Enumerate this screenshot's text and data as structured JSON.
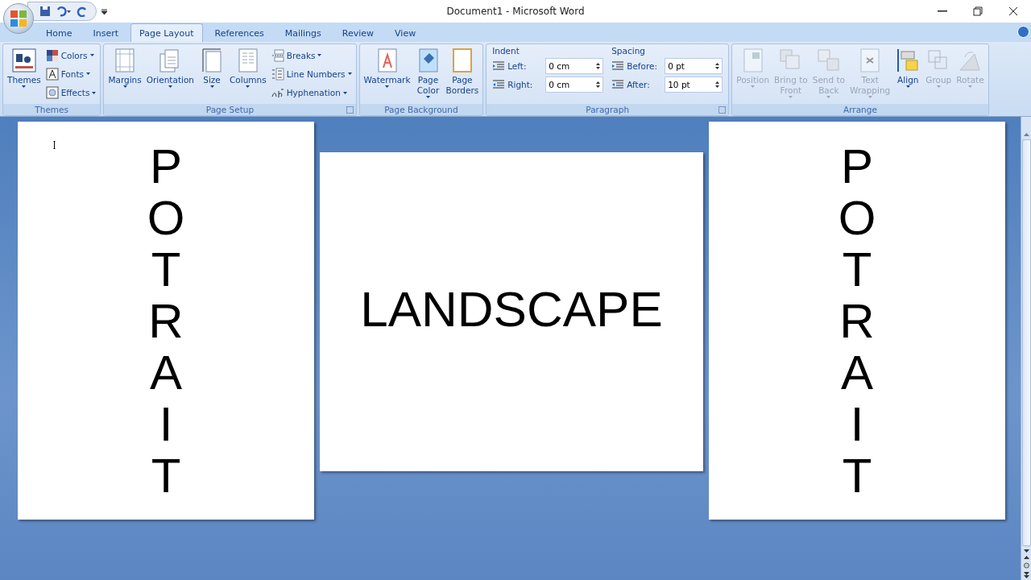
{
  "window": {
    "title": "Document1 - Microsoft Word"
  },
  "tabs": [
    {
      "label": "Home",
      "selected": false
    },
    {
      "label": "Insert",
      "selected": false
    },
    {
      "label": "Page Layout",
      "selected": true
    },
    {
      "label": "References",
      "selected": false
    },
    {
      "label": "Mailings",
      "selected": false
    },
    {
      "label": "Review",
      "selected": false
    },
    {
      "label": "View",
      "selected": false
    }
  ],
  "ribbon": {
    "groups": [
      {
        "title": "Themes",
        "launcher": false,
        "controls": [
          {
            "kind": "large",
            "label": "Themes",
            "dropdown": true,
            "disabled": false
          },
          {
            "kind": "stack",
            "items": [
              {
                "label": "Colors",
                "dropdown": true
              },
              {
                "label": "Fonts",
                "dropdown": true
              },
              {
                "label": "Effects",
                "dropdown": true
              }
            ]
          }
        ]
      },
      {
        "title": "Page Setup",
        "launcher": true,
        "controls": [
          {
            "kind": "large",
            "label": "Margins",
            "dropdown": true,
            "disabled": false
          },
          {
            "kind": "large",
            "label": "Orientation",
            "dropdown": true,
            "disabled": false
          },
          {
            "kind": "large",
            "label": "Size",
            "dropdown": true,
            "disabled": false
          },
          {
            "kind": "large",
            "label": "Columns",
            "dropdown": true,
            "disabled": false
          },
          {
            "kind": "stack",
            "items": [
              {
                "label": "Breaks",
                "dropdown": true
              },
              {
                "label": "Line Numbers",
                "dropdown": true
              },
              {
                "label": "Hyphenation",
                "dropdown": true
              }
            ]
          }
        ]
      },
      {
        "title": "Page Background",
        "launcher": false,
        "controls": [
          {
            "kind": "large",
            "label": "Watermark",
            "dropdown": true,
            "disabled": false
          },
          {
            "kind": "large",
            "label": "Page\nColor",
            "dropdown": true,
            "disabled": false
          },
          {
            "kind": "large",
            "label": "Page\nBorders",
            "dropdown": false,
            "disabled": false
          }
        ]
      },
      {
        "title": "Paragraph",
        "launcher": true,
        "controls": [
          {
            "kind": "fields",
            "heading": "Indent",
            "fields": [
              {
                "label": "Left:",
                "value": "0 cm"
              },
              {
                "label": "Right:",
                "value": "0 cm"
              }
            ]
          },
          {
            "kind": "fields",
            "heading": "Spacing",
            "fields": [
              {
                "label": "Before:",
                "value": "0 pt"
              },
              {
                "label": "After:",
                "value": "10 pt"
              }
            ]
          }
        ]
      },
      {
        "title": "Arrange",
        "launcher": false,
        "controls": [
          {
            "kind": "large",
            "label": "Position",
            "dropdown": true,
            "disabled": true
          },
          {
            "kind": "large",
            "label": "Bring to\nFront",
            "dropdown": true,
            "disabled": true
          },
          {
            "kind": "large",
            "label": "Send to\nBack",
            "dropdown": true,
            "disabled": true
          },
          {
            "kind": "large",
            "label": "Text\nWrapping",
            "dropdown": true,
            "disabled": true
          },
          {
            "kind": "large",
            "label": "Align",
            "dropdown": true,
            "disabled": false
          },
          {
            "kind": "large",
            "label": "Group",
            "dropdown": true,
            "disabled": true
          },
          {
            "kind": "large",
            "label": "Rotate",
            "dropdown": true,
            "disabled": true
          }
        ]
      }
    ]
  },
  "pages": [
    {
      "kind": "portrait",
      "text": "POTRAIT"
    },
    {
      "kind": "landscape",
      "text": "LANDSCAPE"
    },
    {
      "kind": "portrait",
      "text": "POTRAIT"
    }
  ]
}
